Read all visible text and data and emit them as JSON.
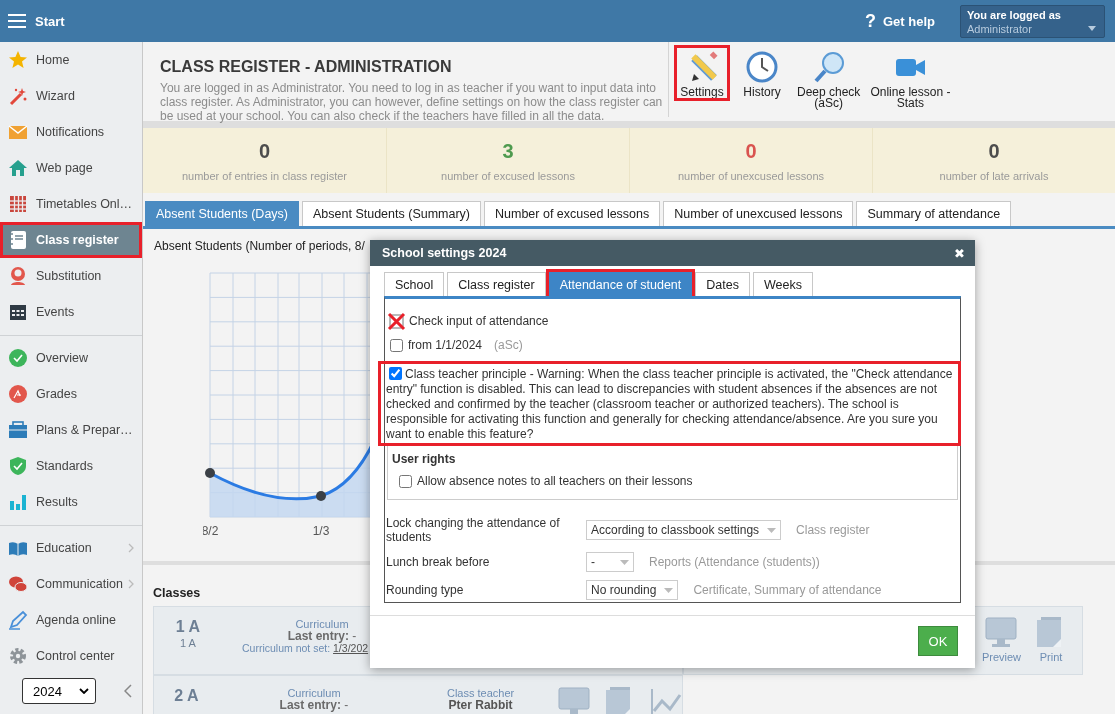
{
  "top_bar": {
    "title": "Start",
    "help": {
      "icon": "?",
      "label": "Get help"
    },
    "user": {
      "caption": "You are logged as",
      "name": "Administrator"
    }
  },
  "sidebar": {
    "groups": [
      {
        "items": [
          {
            "label": "Home",
            "selected": false,
            "highlighted": false,
            "submenu": false
          },
          {
            "label": "Wizard",
            "selected": false,
            "highlighted": false,
            "submenu": false
          },
          {
            "label": "Notifications",
            "selected": false,
            "highlighted": false,
            "submenu": false
          },
          {
            "label": "Web page",
            "selected": false,
            "highlighted": false,
            "submenu": false
          },
          {
            "label": "Timetables Onl…",
            "selected": false,
            "highlighted": false,
            "submenu": false
          },
          {
            "label": "Class register",
            "selected": true,
            "highlighted": true,
            "submenu": false
          },
          {
            "label": "Substitution",
            "selected": false,
            "highlighted": false,
            "submenu": false
          },
          {
            "label": "Events",
            "selected": false,
            "highlighted": false,
            "submenu": false
          }
        ]
      },
      {
        "items": [
          {
            "label": "Overview",
            "selected": false,
            "highlighted": false,
            "submenu": false
          },
          {
            "label": "Grades",
            "selected": false,
            "highlighted": false,
            "submenu": false
          },
          {
            "label": "Plans & Prepar…",
            "selected": false,
            "highlighted": false,
            "submenu": false
          },
          {
            "label": "Standards",
            "selected": false,
            "highlighted": false,
            "submenu": false
          },
          {
            "label": "Results",
            "selected": false,
            "highlighted": false,
            "submenu": false
          }
        ]
      },
      {
        "items": [
          {
            "label": "Education",
            "selected": false,
            "highlighted": false,
            "submenu": true
          },
          {
            "label": "Communication",
            "selected": false,
            "highlighted": false,
            "submenu": true
          },
          {
            "label": "Agenda online",
            "selected": false,
            "highlighted": false,
            "submenu": false
          },
          {
            "label": "Control center",
            "selected": false,
            "highlighted": false,
            "submenu": false
          }
        ]
      }
    ],
    "year": "2024"
  },
  "header": {
    "title": "CLASS REGISTER - ADMINISTRATION",
    "description": "You are logged in as Administrator. You need to log in as teacher if you want to input data into class register. As Administrator, you can however, define settings on how the class register can be used at your school. You can also check if the teachers have filled in all the data.",
    "toolbar": [
      {
        "label": "Settings",
        "highlighted": true
      },
      {
        "label": "History",
        "highlighted": false
      },
      {
        "label": "Deep check\n(aSc)",
        "highlighted": false
      },
      {
        "label": "Online lesson -\nStats",
        "highlighted": false
      }
    ]
  },
  "stats": [
    {
      "value": "0",
      "label": "number of entries in class register",
      "color": "#4d4d4d"
    },
    {
      "value": "3",
      "label": "number of excused lessons",
      "color": "#4e9a4e"
    },
    {
      "value": "0",
      "label": "number of unexcused lessons",
      "color": "#d9534f"
    },
    {
      "value": "0",
      "label": "number of late arrivals",
      "color": "#4d4d4d"
    }
  ],
  "tabs": [
    {
      "label": "Absent Students (Days)",
      "selected": true
    },
    {
      "label": "Absent Students (Summary)",
      "selected": false
    },
    {
      "label": "Number of excused lessons",
      "selected": false
    },
    {
      "label": "Number of unexcused lessons",
      "selected": false
    },
    {
      "label": "Summary of attendance",
      "selected": false
    }
  ],
  "chart": {
    "title": "Absent Students (Number of periods, 8/",
    "x_labels": [
      "8/2",
      "1/3"
    ]
  },
  "classes": {
    "title": "Classes",
    "rows": [
      {
        "name": "1 A",
        "code": "1 A",
        "curriculum": "Curriculum",
        "last_entry": "**Last entry:** -",
        "note": "Curriculum not set:",
        "note_link": "1/3/202",
        "actions": [
          "Preview",
          "Print"
        ]
      },
      {
        "name": "2 A",
        "curriculum": "Curriculum",
        "last_entry": "**Last entry:** -",
        "teacher_label": "Class teacher",
        "teacher": "Pter Rabbit"
      }
    ]
  },
  "dialog": {
    "title": "School settings 2024",
    "close": "✖",
    "tabs": [
      {
        "label": "School",
        "selected": false,
        "highlighted": false
      },
      {
        "label": "Class register",
        "selected": false,
        "highlighted": false
      },
      {
        "label": "Attendance of student",
        "selected": true,
        "highlighted": true
      },
      {
        "label": "Dates",
        "selected": false,
        "highlighted": false
      },
      {
        "label": "Weeks",
        "selected": false,
        "highlighted": false
      }
    ],
    "options": [
      {
        "kind": "crossed",
        "highlighted": false,
        "label": "Check input of attendance"
      },
      {
        "kind": "checkbox",
        "checked": false,
        "highlighted": false,
        "label": "from 1/1/2024",
        "note": "(aSc)"
      },
      {
        "kind": "checkbox",
        "checked": true,
        "highlighted": true,
        "label": "Class teacher principle - Warning: When the class teacher principle is activated, the \"Check attendance entry\" function is disabled. This can lead to discrepancies with student absences if the absences are not checked and confirmed by the teacher (classroom teacher or authorized teachers). The school is responsible for activating this function and generally for checking attendance/absence. Are you sure you want to enable this feature?"
      }
    ],
    "user_rights": {
      "title": "User rights",
      "options": [
        {
          "checked": false,
          "label": "Allow absence notes to all teachers on their lessons"
        }
      ]
    },
    "settings": [
      {
        "label": "Lock changing the attendance of students",
        "value": "According to classbook settings",
        "note": "Class register"
      },
      {
        "label": "Lunch break before",
        "value": "-",
        "note": "Reports (Attendance (students))"
      },
      {
        "label": "Rounding type",
        "value": "No rounding",
        "note": "Certificate, Summary of attendance"
      }
    ],
    "ok": "OK"
  }
}
